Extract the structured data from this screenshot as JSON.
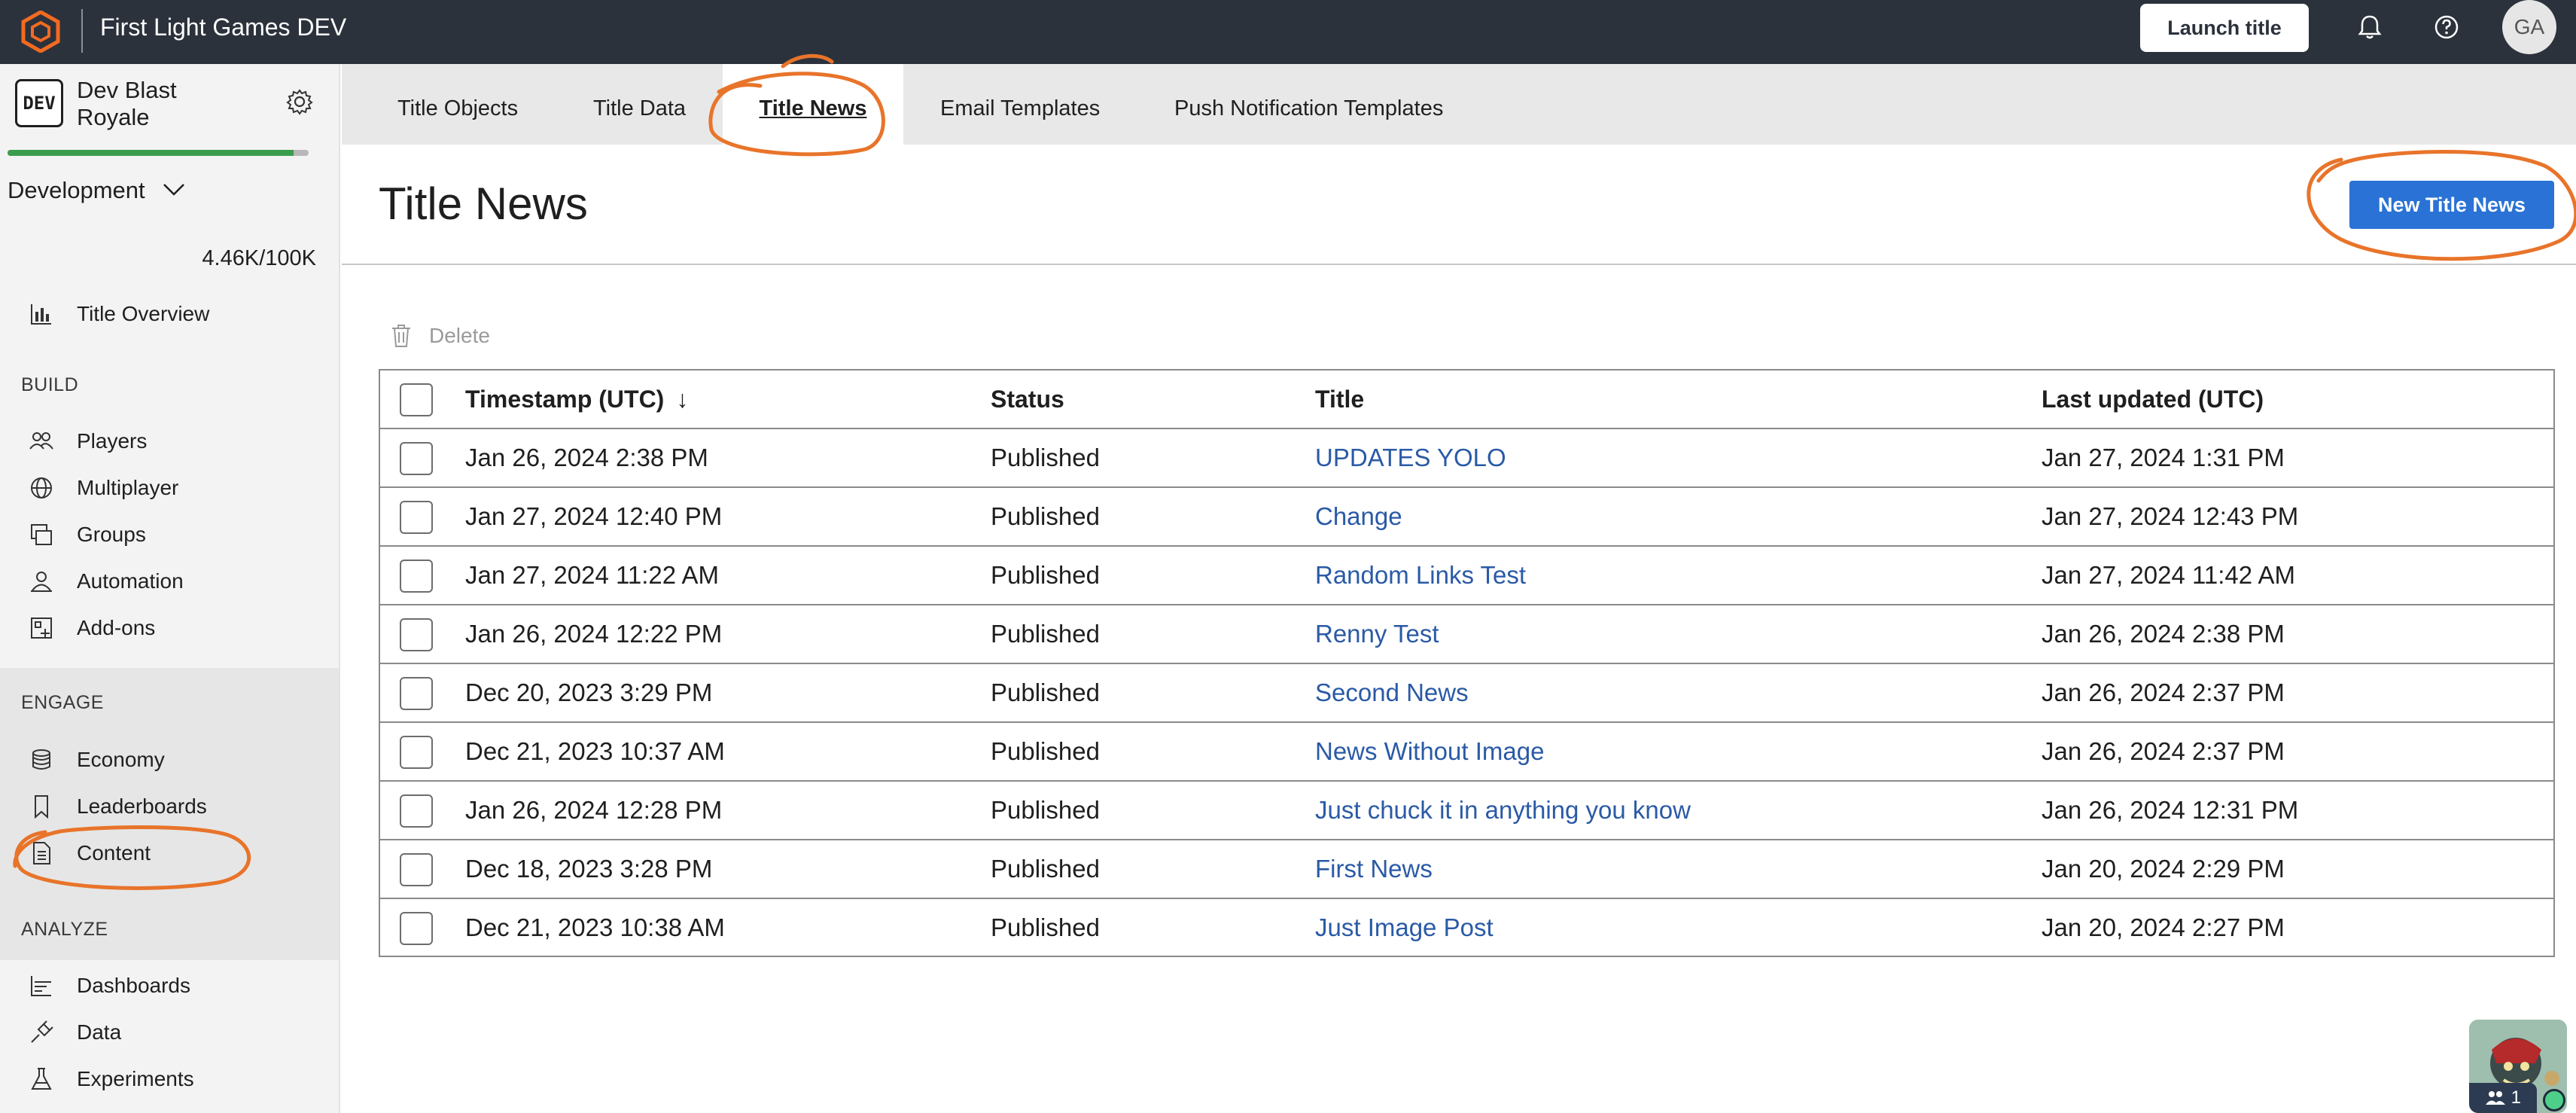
{
  "topbar": {
    "app_title": "First Light Games DEV",
    "launch_label": "Launch title",
    "bell_icon": "bell-icon",
    "help_icon": "help-icon",
    "avatar_initials": "GA"
  },
  "sidebar": {
    "badge": "DEV",
    "title": "Dev Blast Royale",
    "environment": "Development",
    "usage": "4.46K/100K",
    "usage_fraction": 0.95,
    "overview_label": "Title Overview",
    "sections": {
      "build": "BUILD",
      "engage": "ENGAGE",
      "analyze": "ANALYZE"
    },
    "build_items": [
      {
        "label": "Players",
        "icon": "players-icon"
      },
      {
        "label": "Multiplayer",
        "icon": "globe-icon"
      },
      {
        "label": "Groups",
        "icon": "groups-icon"
      },
      {
        "label": "Automation",
        "icon": "automation-icon"
      },
      {
        "label": "Add-ons",
        "icon": "addons-icon"
      }
    ],
    "engage_items": [
      {
        "label": "Economy",
        "icon": "economy-icon"
      },
      {
        "label": "Leaderboards",
        "icon": "leaderboards-icon"
      },
      {
        "label": "Content",
        "icon": "content-icon"
      }
    ],
    "analyze_items": [
      {
        "label": "Dashboards",
        "icon": "dashboards-icon"
      },
      {
        "label": "Data",
        "icon": "data-icon"
      },
      {
        "label": "Experiments",
        "icon": "experiments-icon"
      }
    ]
  },
  "tabs": [
    {
      "label": "Title Objects",
      "active": false
    },
    {
      "label": "Title Data",
      "active": false
    },
    {
      "label": "Title News",
      "active": true
    },
    {
      "label": "Email Templates",
      "active": false
    },
    {
      "label": "Push Notification Templates",
      "active": false
    }
  ],
  "main": {
    "page_title": "Title News",
    "new_button_label": "New Title News",
    "delete_label": "Delete",
    "table": {
      "headers": {
        "timestamp": "Timestamp (UTC)",
        "sort_indicator": "↓",
        "status": "Status",
        "title": "Title",
        "last_updated": "Last updated (UTC)"
      },
      "rows": [
        {
          "timestamp": "Jan 26, 2024 2:38 PM",
          "status": "Published",
          "title": "UPDATES YOLO",
          "last_updated": "Jan 27, 2024 1:31 PM"
        },
        {
          "timestamp": "Jan 27, 2024 12:40 PM",
          "status": "Published",
          "title": "Change",
          "last_updated": "Jan 27, 2024 12:43 PM"
        },
        {
          "timestamp": "Jan 27, 2024 11:22 AM",
          "status": "Published",
          "title": "Random Links Test",
          "last_updated": "Jan 27, 2024 11:42 AM"
        },
        {
          "timestamp": "Jan 26, 2024 12:22 PM",
          "status": "Published",
          "title": "Renny Test",
          "last_updated": "Jan 26, 2024 2:38 PM"
        },
        {
          "timestamp": "Dec 20, 2023 3:29 PM",
          "status": "Published",
          "title": "Second News",
          "last_updated": "Jan 26, 2024 2:37 PM"
        },
        {
          "timestamp": "Dec 21, 2023 10:37 AM",
          "status": "Published",
          "title": "News Without Image",
          "last_updated": "Jan 26, 2024 2:37 PM"
        },
        {
          "timestamp": "Jan 26, 2024 12:28 PM",
          "status": "Published",
          "title": "Just chuck it in anything you know",
          "last_updated": "Jan 26, 2024 12:31 PM"
        },
        {
          "timestamp": "Dec 18, 2023 3:28 PM",
          "status": "Published",
          "title": "First News",
          "last_updated": "Jan 20, 2024 2:29 PM"
        },
        {
          "timestamp": "Dec 21, 2023 10:38 AM",
          "status": "Published",
          "title": "Just Image Post",
          "last_updated": "Jan 20, 2024 2:27 PM"
        }
      ]
    }
  },
  "presence": {
    "count": "1"
  },
  "colors": {
    "topbar": "#2c323c",
    "accent": "#2a72d5",
    "link": "#2a5aa6",
    "annotation": "#e8742a",
    "progress": "#3a9d4e"
  }
}
